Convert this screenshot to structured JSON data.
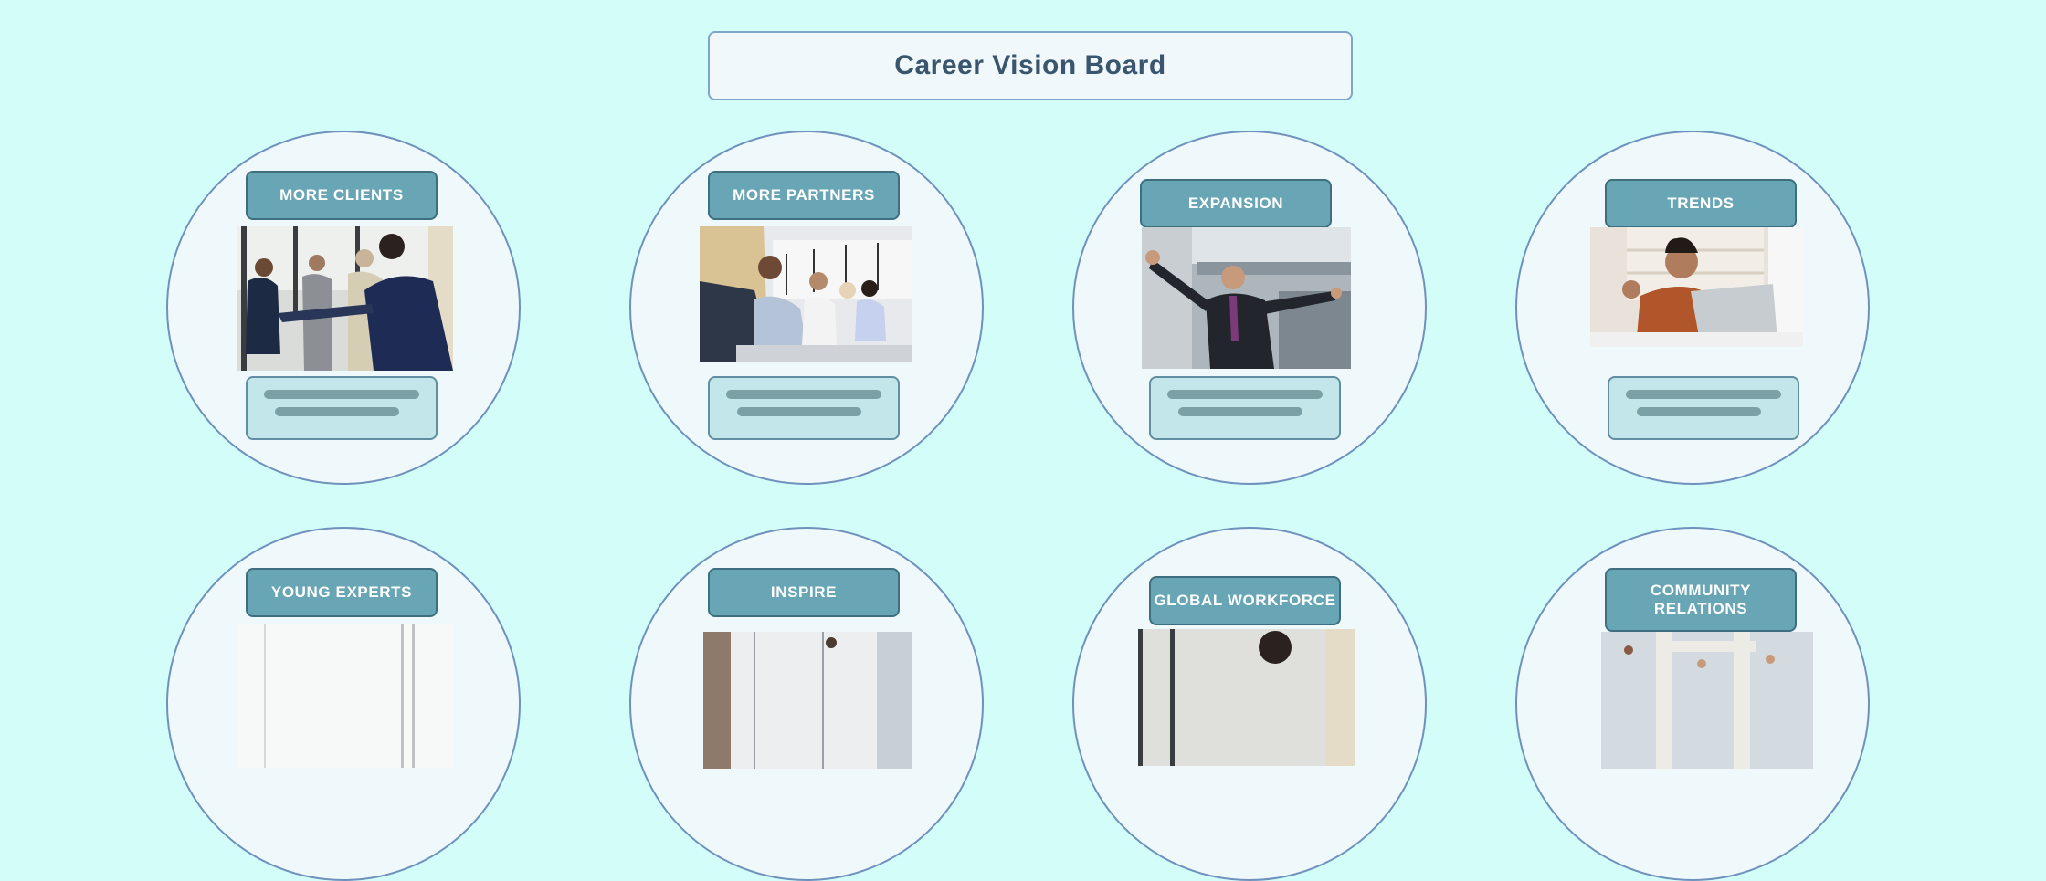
{
  "header": {
    "title": "Career Vision Board"
  },
  "colors": {
    "background": "#d2fdf8",
    "circle_fill": "#eff8fb",
    "circle_border": "#6f92bd",
    "label_fill": "#68a5b5",
    "textbox_fill": "#c2e6ea",
    "placeholder_bar": "#7ba0a6",
    "title_text": "#3a556e"
  },
  "goals": [
    {
      "label": "MORE CLIENTS",
      "image": "business people shaking hands in office"
    },
    {
      "label": "MORE PARTNERS",
      "image": "team laughing around meeting table"
    },
    {
      "label": "EXPANSION",
      "image": "man in suit with arms outstretched"
    },
    {
      "label": "TRENDS",
      "image": "man celebrating at laptop"
    },
    {
      "label": "YOUNG EXPERTS",
      "image": "bright office scene"
    },
    {
      "label": "INSPIRE",
      "image": "presenter in office meeting"
    },
    {
      "label": "GLOBAL WORKFORCE",
      "image": "office team with curly haired man"
    },
    {
      "label": "COMMUNITY RELATIONS",
      "image": "raised hands celebrating"
    }
  ]
}
